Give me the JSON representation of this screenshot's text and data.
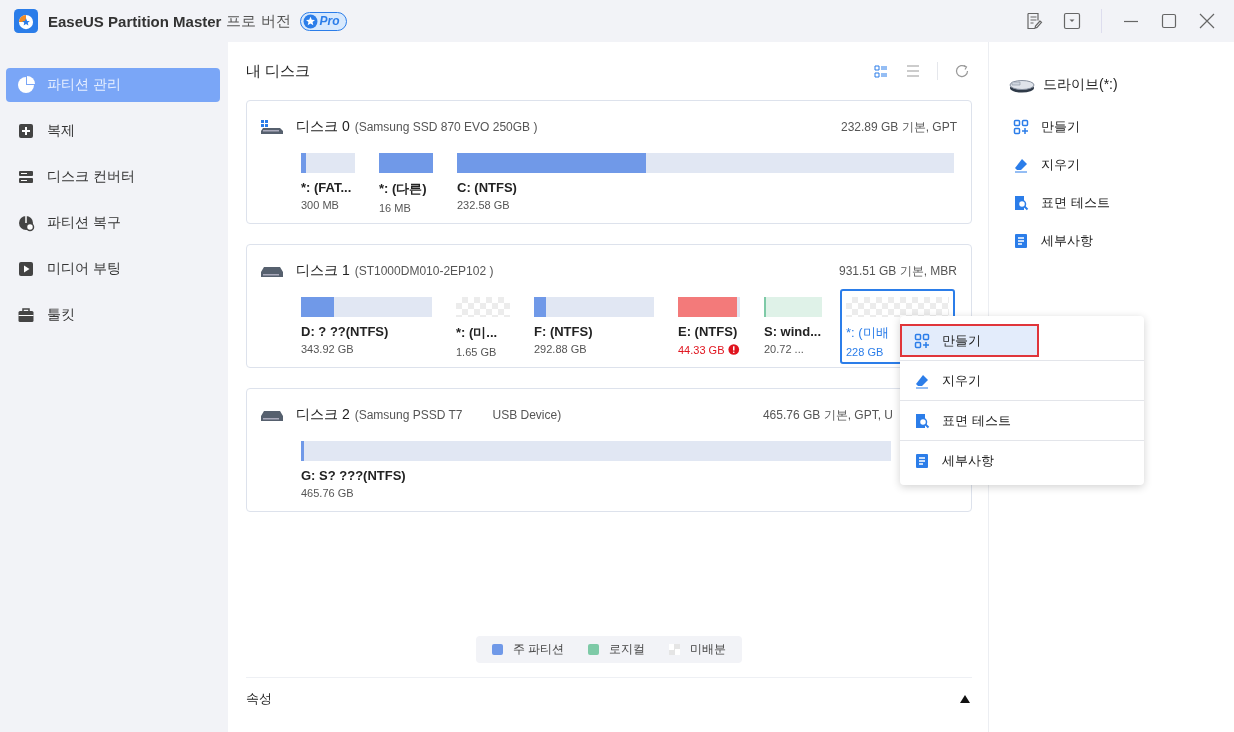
{
  "window": {
    "title": "EaseUS Partition Master",
    "edition": "프로 버전",
    "badge": "Pro"
  },
  "sidebar": {
    "items": [
      {
        "label": "파티션 관리",
        "selected": true
      },
      {
        "label": "복제",
        "selected": false
      },
      {
        "label": "디스크 컨버터",
        "selected": false
      },
      {
        "label": "파티션 복구",
        "selected": false
      },
      {
        "label": "미디어 부팅",
        "selected": false
      },
      {
        "label": "툴킷",
        "selected": false
      }
    ]
  },
  "main": {
    "title": "내 디스크",
    "disks": [
      {
        "name": "디스크 0",
        "model": "(Samsung SSD 870 EVO 250GB )",
        "info": "232.89 GB 기본, GPT",
        "partitions": [
          {
            "label": "*: (FAT...",
            "size": "300 MB",
            "kind": "primary",
            "level": 0.1,
            "warning": false,
            "selected": false
          },
          {
            "label": "*: (다른)",
            "size": "16 MB",
            "kind": "primary",
            "level": 1,
            "warning": false,
            "selected": false
          },
          {
            "label": "C: (NTFS)",
            "size": "232.58 GB",
            "kind": "primary",
            "level": 0.38,
            "warning": false,
            "selected": false
          }
        ]
      },
      {
        "name": "디스크 1",
        "model": "(ST1000DM010-2EP102 )",
        "info": "931.51 GB 기본, MBR",
        "partitions": [
          {
            "label": "D: ? ??(NTFS)",
            "size": "343.92 GB",
            "kind": "primary",
            "level": 0.25,
            "warning": false,
            "selected": false
          },
          {
            "label": "*: (미...",
            "size": "1.65 GB",
            "kind": "unallocated",
            "warning": false,
            "selected": false
          },
          {
            "label": "F: (NTFS)",
            "size": "292.88 GB",
            "kind": "primary",
            "level": 0.1,
            "warning": false,
            "selected": false
          },
          {
            "label": "E: (NTFS)",
            "size": "44.33 GB",
            "kind": "primary",
            "level": 0.95,
            "warning": true,
            "selected": false
          },
          {
            "label": "S: wind...",
            "size": "20.72 ...",
            "kind": "logical",
            "level": 0.03,
            "warning": false,
            "selected": false
          },
          {
            "label": "*: (미배",
            "size": "228 GB",
            "kind": "unallocated",
            "warning": false,
            "selected": true
          }
        ]
      },
      {
        "name": "디스크 2",
        "model": "(Samsung  PSSD T7",
        "extra": "USB Device)",
        "info": "465.76 GB 기본, GPT, U",
        "partitions": [
          {
            "label": "G: S? ???(NTFS)",
            "size": "465.76 GB",
            "kind": "primary",
            "level": 0.005,
            "warning": false,
            "selected": false
          }
        ]
      }
    ],
    "legend": [
      {
        "label": "주 파티션",
        "kind": "primary"
      },
      {
        "label": "로지컬",
        "kind": "logical"
      },
      {
        "label": "미배분",
        "kind": "unallocated"
      }
    ],
    "properties": "속성"
  },
  "context_menu": [
    {
      "label": "만들기",
      "selected": true
    },
    {
      "label": "지우기",
      "selected": false
    },
    {
      "label": "표면 테스트",
      "selected": false
    },
    {
      "label": "세부사항",
      "selected": false
    }
  ],
  "actions": {
    "drive": "드라이브(*:)",
    "items": [
      "만들기",
      "지우기",
      "표면 테스트",
      "세부사항"
    ]
  }
}
